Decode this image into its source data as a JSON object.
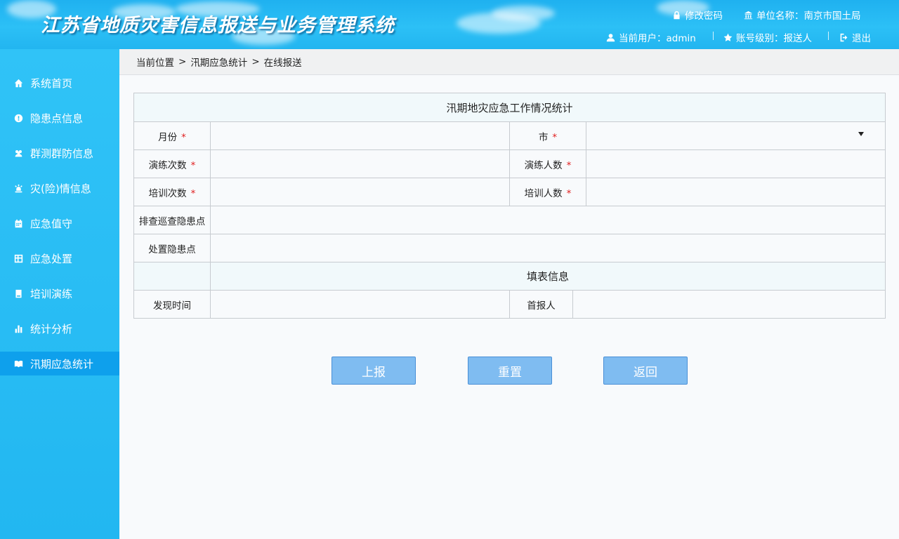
{
  "header": {
    "title": "江苏省地质灾害信息报送与业务管理系统",
    "change_password": "修改密码",
    "unit_name": "单位名称：南京市国土局",
    "current_user": "当前用户：admin",
    "account_level": "账号级别：报送人",
    "logout": "退出"
  },
  "sidebar": {
    "items": [
      {
        "label": "系统首页",
        "icon": "home-icon"
      },
      {
        "label": "隐患点信息",
        "icon": "alert-circle-icon"
      },
      {
        "label": "群测群防信息",
        "icon": "users-icon"
      },
      {
        "label": "灾(险)情信息",
        "icon": "siren-icon"
      },
      {
        "label": "应急值守",
        "icon": "calendar-icon"
      },
      {
        "label": "应急处置",
        "icon": "grid-icon"
      },
      {
        "label": "培训演练",
        "icon": "book-icon"
      },
      {
        "label": "统计分析",
        "icon": "bar-chart-icon"
      },
      {
        "label": "汛期应急统计",
        "icon": "open-book-icon"
      }
    ],
    "active_index": 8
  },
  "breadcrumb": {
    "items": [
      "当前位置",
      "汛期应急统计",
      "在线报送"
    ],
    "separator": ">"
  },
  "form": {
    "title": "汛期地灾应急工作情况统计",
    "month_label": "月份",
    "city_label": "市",
    "drill_count_label": "演练次数",
    "drill_people_label": "演练人数",
    "training_count_label": "培训次数",
    "training_people_label": "培训人数",
    "inspect_label": "排查巡查隐患点",
    "dispose_label": "处置隐患点",
    "fill_info_title": "填表信息",
    "discover_time_label": "发现时间",
    "reporter_label": "首报人",
    "required_mark": "*",
    "city_value": ""
  },
  "buttons": {
    "submit": "上报",
    "reset": "重置",
    "back": "返回"
  },
  "colors": {
    "header_blue": "#1fb1f0",
    "sidebar_blue": "#2ab9f3",
    "active_item": "#0ea0ec",
    "button_fill": "#7fbcf1",
    "required_red": "#e02020"
  }
}
